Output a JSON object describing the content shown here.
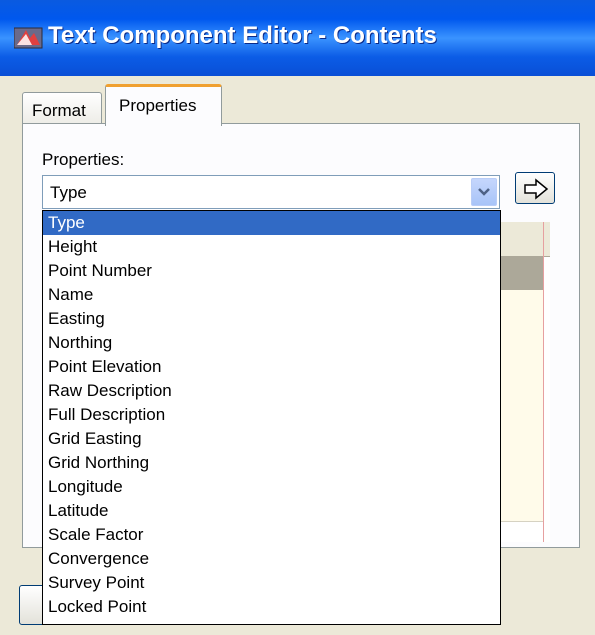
{
  "window": {
    "title": "Text Component Editor - Contents"
  },
  "tabs": [
    {
      "label": "Format",
      "active": false
    },
    {
      "label": "Properties",
      "active": true
    }
  ],
  "properties_label": "Properties:",
  "combo": {
    "selected": "Type"
  },
  "dropdown": {
    "selected_index": 0,
    "options": [
      "Type",
      "Height",
      "Point Number",
      "Name",
      "Easting",
      "Northing",
      "Point Elevation",
      "Raw Description",
      "Full Description",
      "Grid Easting",
      "Grid Northing",
      "Longitude",
      "Latitude",
      "Scale Factor",
      "Convergence",
      "Survey Point",
      "Locked Point"
    ]
  },
  "icons": {
    "app": "app-icon",
    "combo_arrow": "chevron-down-icon",
    "insert": "arrow-right-icon"
  },
  "colors": {
    "titlebar": "#0058ee",
    "selection": "#316ac5",
    "tab_accent": "#f0a030"
  }
}
